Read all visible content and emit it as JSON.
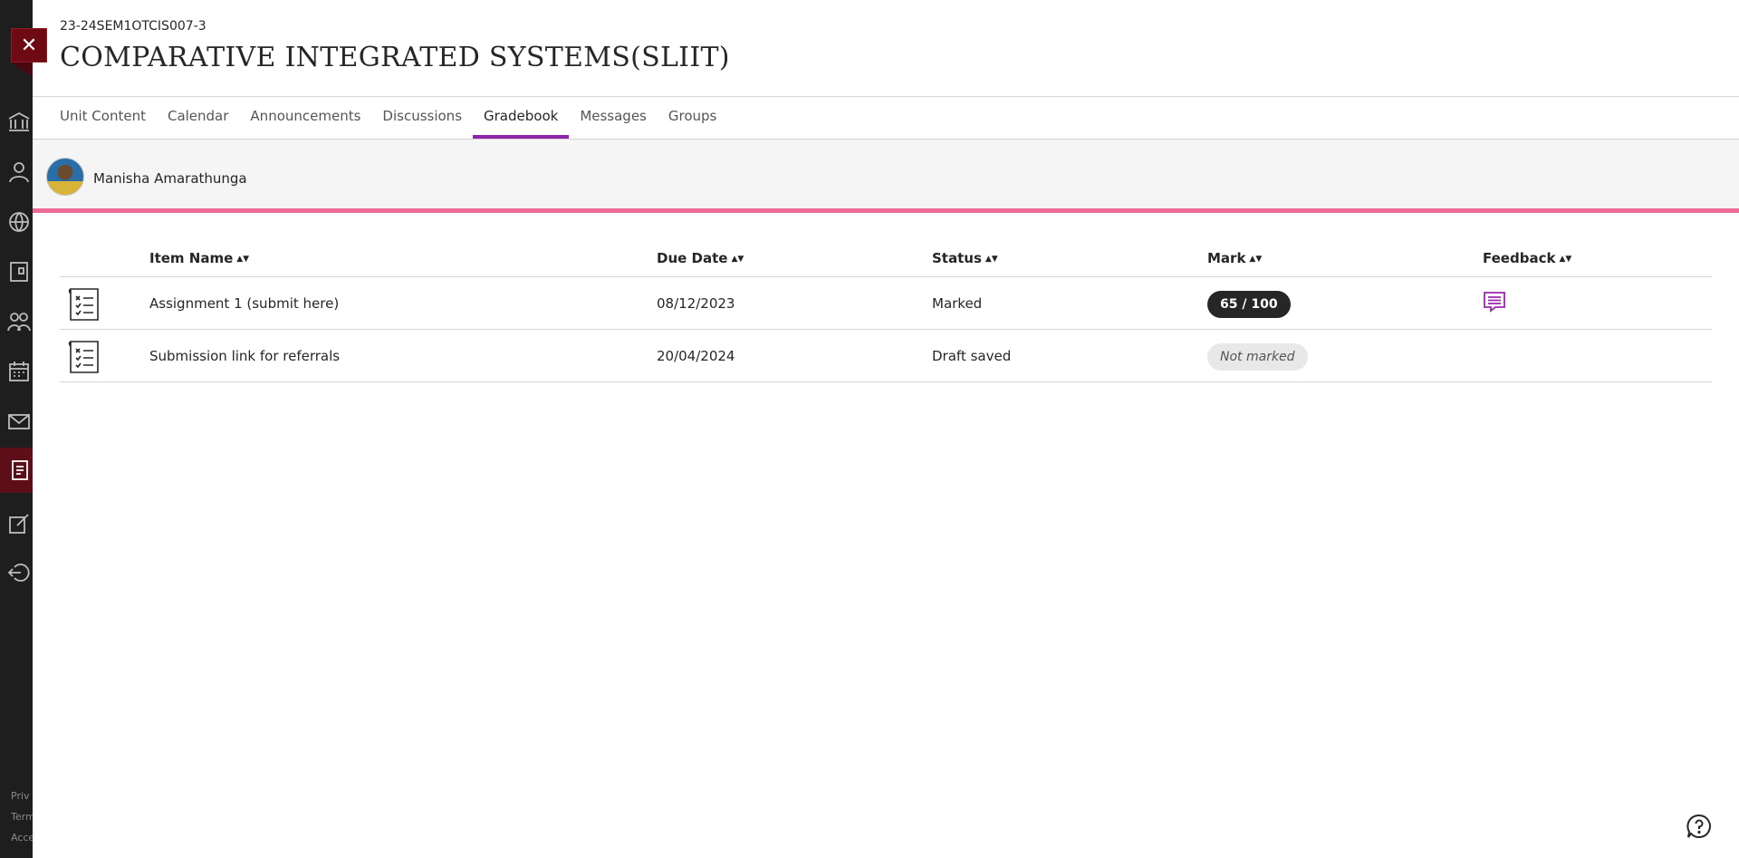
{
  "course": {
    "code": "23-24SEM1OTCIS007-3",
    "title": "COMPARATIVE INTEGRATED SYSTEMS(SLIIT)"
  },
  "tabs": [
    {
      "label": "Unit Content"
    },
    {
      "label": "Calendar"
    },
    {
      "label": "Announcements"
    },
    {
      "label": "Discussions"
    },
    {
      "label": "Gradebook"
    },
    {
      "label": "Messages"
    },
    {
      "label": "Groups"
    }
  ],
  "active_tab": "Gradebook",
  "user": {
    "name": "Manisha Amarathunga"
  },
  "table": {
    "headers": {
      "item_name": "Item Name",
      "due_date": "Due Date",
      "status": "Status",
      "mark": "Mark",
      "feedback": "Feedback"
    },
    "rows": [
      {
        "item": "Assignment 1 (submit here)",
        "due": "08/12/2023",
        "status": "Marked",
        "mark": "65 / 100",
        "feedback_icon": "feedback-icon"
      },
      {
        "item": "Submission link for referrals",
        "due": "20/04/2024",
        "status": "Draft saved",
        "mark": "Not marked"
      }
    ]
  },
  "rail_footer": [
    "Priv",
    "Term",
    "Acce"
  ],
  "colors": {
    "accent_tab": "#8e24aa",
    "strip": "#ec6b96",
    "close": "#6e0a14",
    "rail": "#1e1e1e"
  }
}
